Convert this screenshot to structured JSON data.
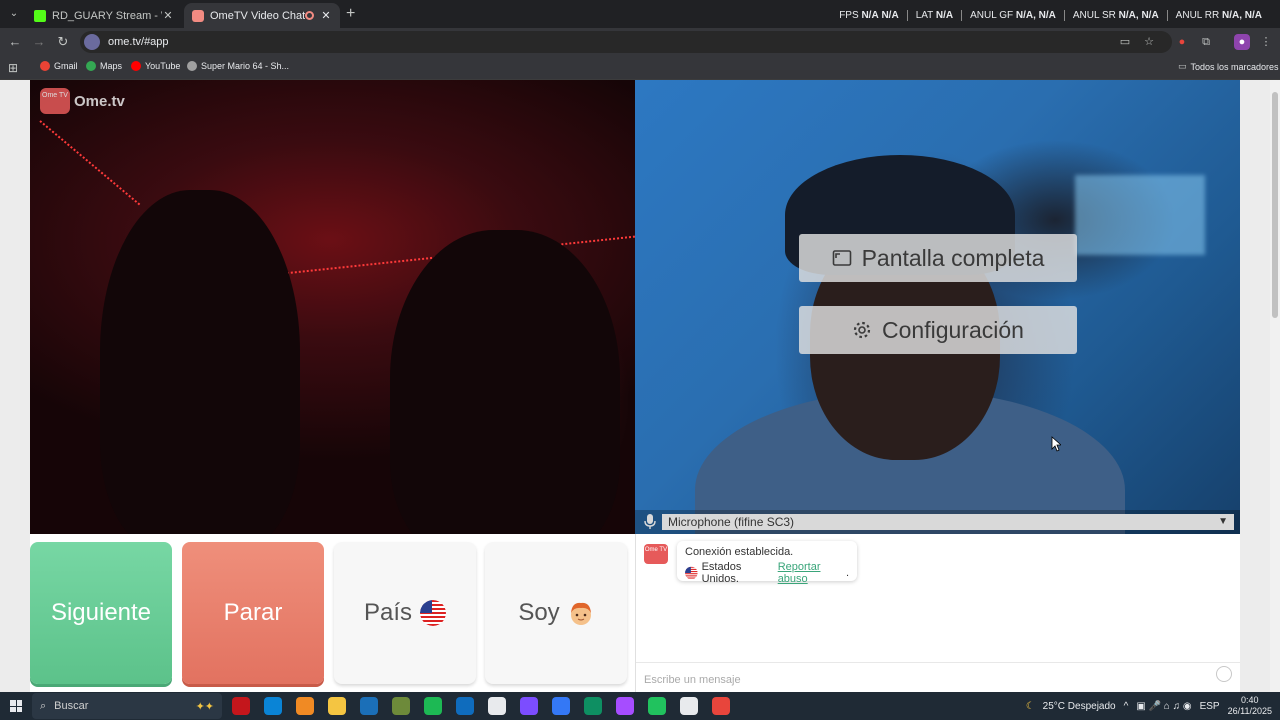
{
  "browser": {
    "tabs": [
      {
        "title": "RD_GUARY Stream - Watch Live",
        "favicon_color": "#53fc18",
        "close": "✕"
      },
      {
        "title": "OmeTV Video Chat — Omegle",
        "favicon_color": "#f28b82",
        "close": "✕"
      }
    ],
    "new_tab": "+",
    "stats": [
      {
        "label": "FPS",
        "value": "N/A",
        "value2": "N/A"
      },
      {
        "label": "LAT",
        "value": "N/A",
        "value2": ""
      },
      {
        "label": "ANUL GF",
        "value": "N/A,",
        "value2": "N/A"
      },
      {
        "label": "ANUL SR",
        "value": "N/A,",
        "value2": "N/A"
      },
      {
        "label": "ANUL RR",
        "value": "N/A,",
        "value2": "N/A"
      }
    ],
    "url": "ome.tv/#app",
    "bookmarks": [
      {
        "label": "Gmail",
        "color": "#ea4335"
      },
      {
        "label": "Maps",
        "color": "#34a853"
      },
      {
        "label": "YouTube",
        "color": "#ff0000"
      },
      {
        "label": "Super Mario 64 - Sh...",
        "color": "#a0a0a0"
      }
    ],
    "all_bookmarks": "Todos los marcadores"
  },
  "video": {
    "logo_text": "Ome.tv",
    "logo_box": "Ome TV",
    "fullscreen_label": "Pantalla completa",
    "settings_label": "Configuración",
    "microphone": "Microphone (fifine SC3)"
  },
  "controls": {
    "next": "Siguiente",
    "stop": "Parar",
    "country": "País",
    "me": "Soy"
  },
  "chat": {
    "connected": "Conexión establecida.",
    "country": "Estados Unidos.",
    "report": "Reportar abuso",
    "period": ".",
    "placeholder": "Escribe un mensaje"
  },
  "taskbar": {
    "search": "Buscar",
    "weather": "25°C  Despejado",
    "lang": "ESP",
    "time": "0:40",
    "date": "26/11/2025",
    "apps": [
      "#c4161c",
      "#0a84d6",
      "#f08a24",
      "#f4c542",
      "#1b6fb8",
      "#6d8a3a",
      "#1db954",
      "#0f6cbd",
      "#e8eaed",
      "#7c4dff",
      "#3478f6",
      "#0e8f62",
      "#a64dff",
      "#21c25e",
      "#e8eaed",
      "#e8453c"
    ]
  },
  "colors": {
    "next": "#5cc28a",
    "stop": "#e27260",
    "link": "#3aa57a"
  }
}
